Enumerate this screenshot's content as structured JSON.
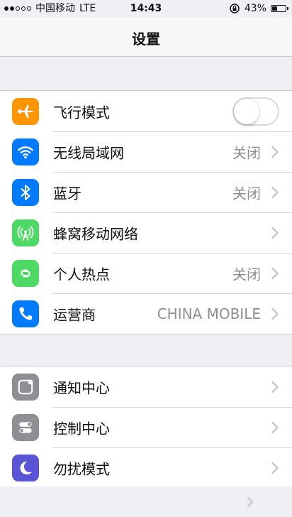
{
  "status_bar": {
    "carrier": "中国移动",
    "network": "LTE",
    "time": "14:43",
    "battery_percent": "43%",
    "battery_level": 0.43,
    "signal_bars_filled": 2,
    "signal_bars_total": 5
  },
  "nav": {
    "title": "设置"
  },
  "group1": {
    "items": [
      {
        "label": "飞行模式",
        "value": "",
        "icon": "airplane-icon",
        "icon_bg": "#ff9500",
        "toggle_on": false
      },
      {
        "label": "无线局域网",
        "value": "关闭",
        "icon": "wifi-icon",
        "icon_bg": "#007aff"
      },
      {
        "label": "蓝牙",
        "value": "关闭",
        "icon": "bluetooth-icon",
        "icon_bg": "#007aff"
      },
      {
        "label": "蜂窝移动网络",
        "value": "",
        "icon": "antenna-icon",
        "icon_bg": "#4cd964"
      },
      {
        "label": "个人热点",
        "value": "关闭",
        "icon": "hotspot-icon",
        "icon_bg": "#4cd964"
      },
      {
        "label": "运营商",
        "value": "CHINA MOBILE",
        "icon": "phone-icon",
        "icon_bg": "#007aff"
      }
    ]
  },
  "group2": {
    "items": [
      {
        "label": "通知中心",
        "icon": "notification-icon",
        "icon_bg": "#8e8e93"
      },
      {
        "label": "控制中心",
        "icon": "control-center-icon",
        "icon_bg": "#8e8e93"
      },
      {
        "label": "勿扰模式",
        "icon": "moon-icon",
        "icon_bg": "#5856d6"
      }
    ]
  }
}
